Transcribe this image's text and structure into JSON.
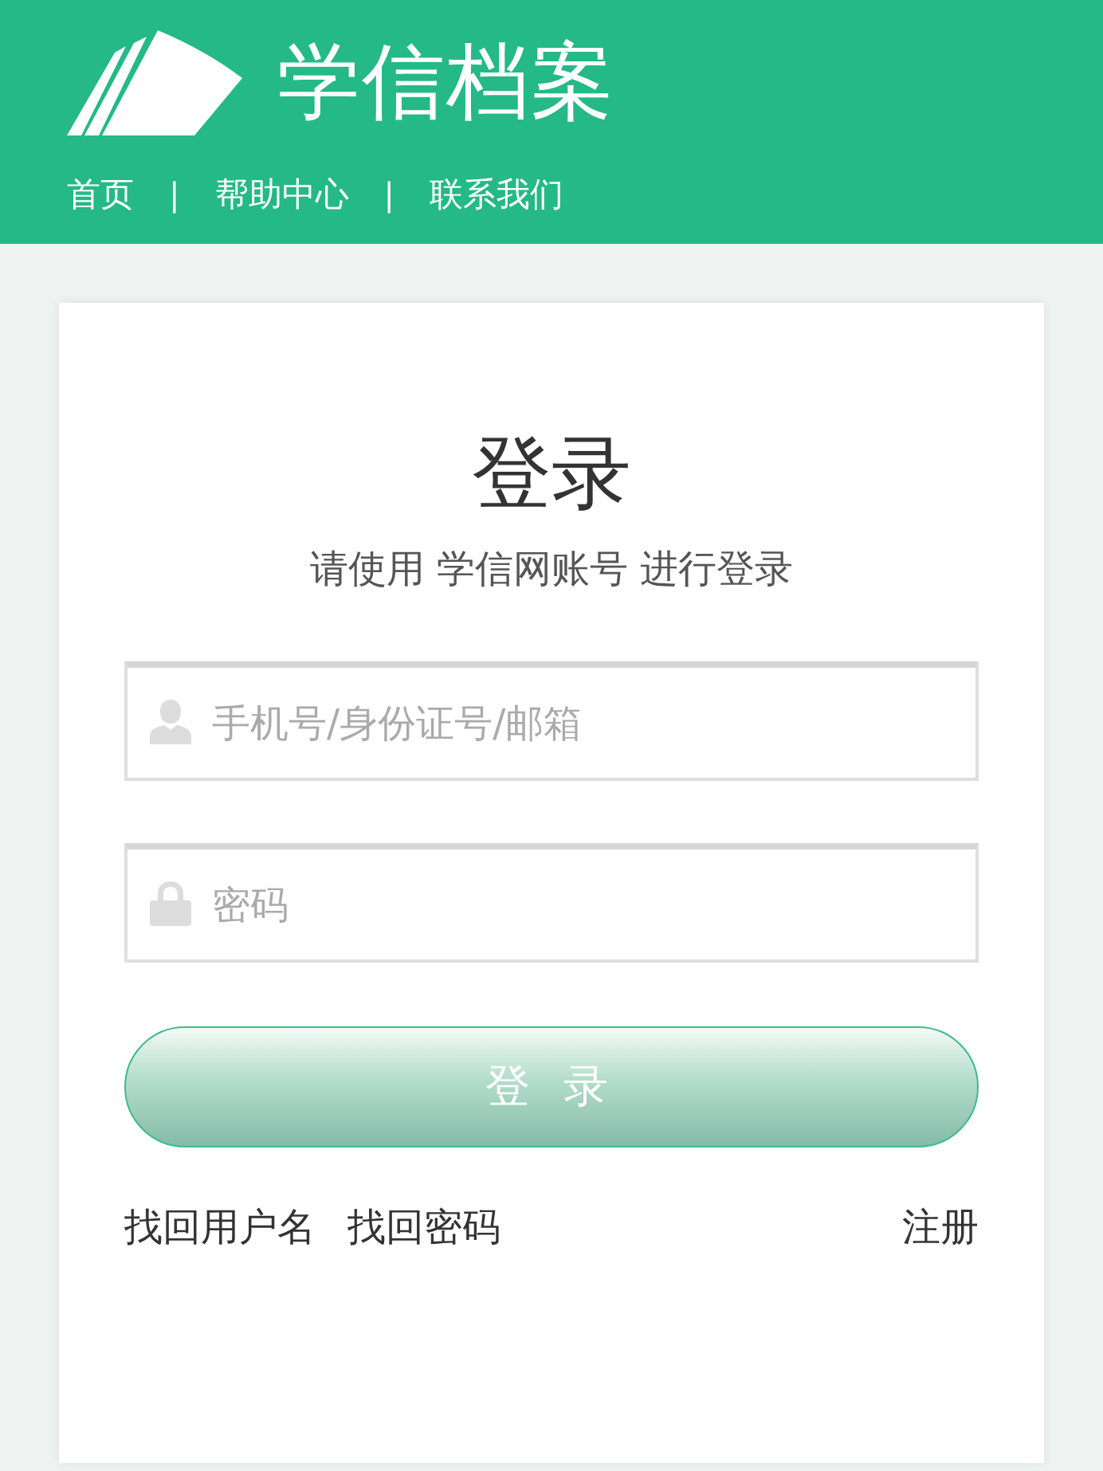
{
  "header": {
    "title": "学信档案",
    "nav": [
      {
        "kind": "link",
        "label": "首页"
      },
      {
        "kind": "separator",
        "label": "|"
      },
      {
        "kind": "link",
        "label": "帮助中心"
      },
      {
        "kind": "separator",
        "label": "|"
      },
      {
        "kind": "link",
        "label": "联系我们"
      }
    ]
  },
  "login": {
    "title": "登录",
    "subtitle": "请使用 学信网账号 进行登录",
    "fields": [
      {
        "kind": "user",
        "placeholder": "手机号/身份证号/邮箱"
      },
      {
        "kind": "password",
        "placeholder": "密码"
      }
    ],
    "submit": "登 录",
    "left_links": [
      {
        "label": "找回用户名"
      },
      {
        "label": "找回密码"
      }
    ],
    "right_links": [
      {
        "label": "注册"
      }
    ]
  }
}
